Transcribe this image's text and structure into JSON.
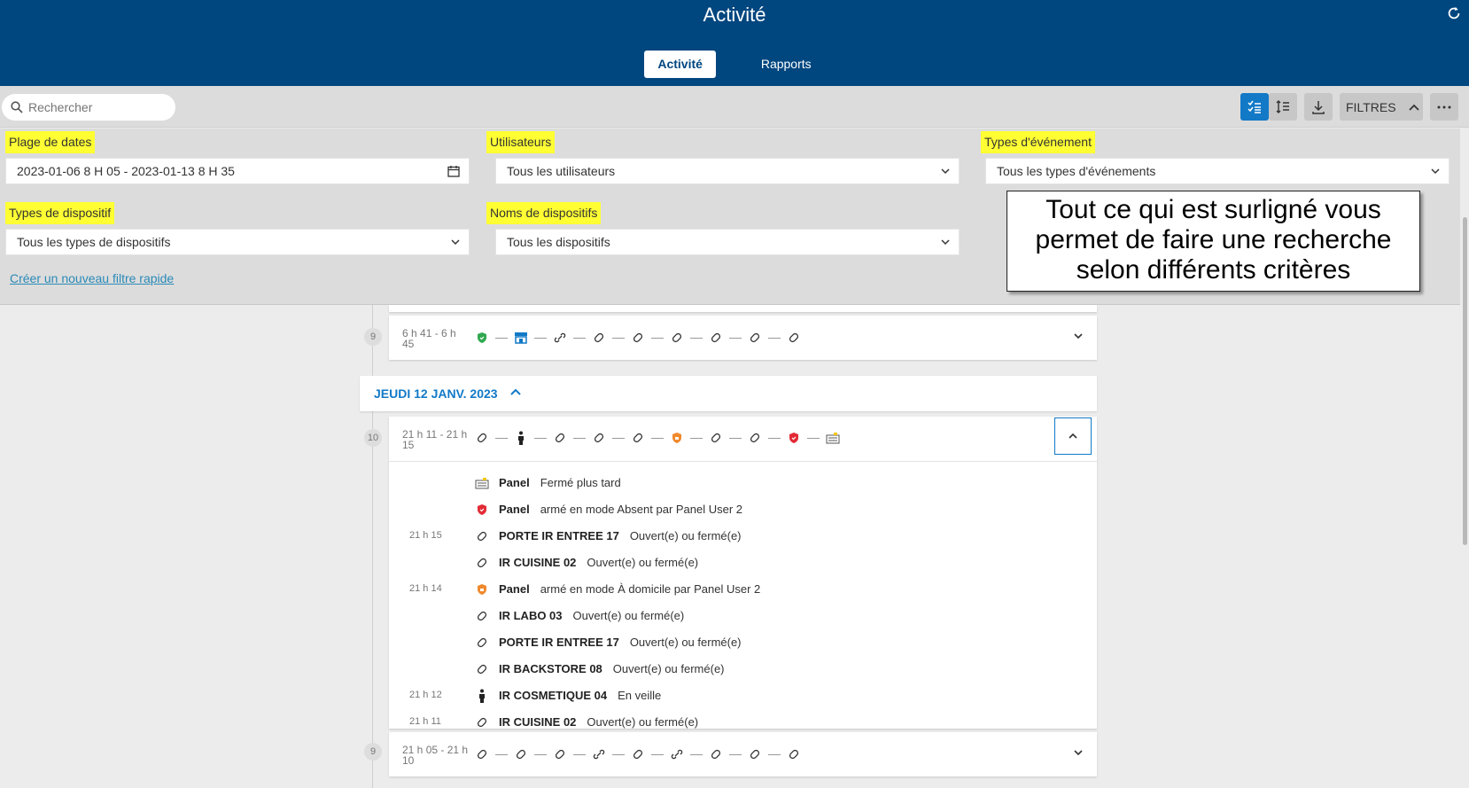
{
  "header": {
    "title": "Activité",
    "tabs": [
      {
        "label": "Activité",
        "active": true
      },
      {
        "label": "Rapports",
        "active": false
      }
    ]
  },
  "toolbar": {
    "search_placeholder": "Rechercher",
    "filters_label": "FILTRES"
  },
  "filters": {
    "date_range": {
      "label": "Plage de dates",
      "value": "2023-01-06 8 H 05 - 2023-01-13 8 H 35"
    },
    "users": {
      "label": "Utilisateurs",
      "value": "Tous les utilisateurs"
    },
    "event_types": {
      "label": "Types d'événement",
      "value": "Tous les types d'événements"
    },
    "device_types": {
      "label": "Types de dispositif",
      "value": "Tous les types de dispositifs"
    },
    "device_names": {
      "label": "Noms de dispositifs",
      "value": "Tous les dispositifs"
    },
    "quick_filter_link": "Créer un nouveau filtre rapide",
    "annotation": [
      "Tout ce qui est surligné vous",
      "permet de faire une recherche",
      "selon différents critères"
    ]
  },
  "timeline": {
    "group1": {
      "count": "9",
      "time_line1": "6 h 41 - 6 h",
      "time_line2": "45"
    },
    "date_header": "JEUDI 12 JANV. 2023",
    "group2": {
      "count": "10",
      "time_line1": "21 h 11 - 21 h",
      "time_line2": "15",
      "events": [
        {
          "time": "",
          "icon": "panel-icon",
          "name": "Panel",
          "desc": "Fermé plus tard"
        },
        {
          "time": "",
          "icon": "shield-red-icon",
          "name": "Panel",
          "desc": "armé en mode Absent par Panel User 2"
        },
        {
          "time": "21 h 15",
          "icon": "link-icon",
          "name": "PORTE IR ENTREE 17",
          "desc": "Ouvert(e) ou fermé(e)"
        },
        {
          "time": "",
          "icon": "link-icon",
          "name": "IR CUISINE 02",
          "desc": "Ouvert(e) ou fermé(e)"
        },
        {
          "time": "21 h 14",
          "icon": "shield-orange-icon",
          "name": "Panel",
          "desc": "armé en mode À domicile par Panel User 2"
        },
        {
          "time": "",
          "icon": "link-icon",
          "name": "IR LABO 03",
          "desc": "Ouvert(e) ou fermé(e)"
        },
        {
          "time": "",
          "icon": "link-icon",
          "name": "PORTE IR ENTREE 17",
          "desc": "Ouvert(e) ou fermé(e)"
        },
        {
          "time": "",
          "icon": "link-icon",
          "name": "IR BACKSTORE 08",
          "desc": "Ouvert(e) ou fermé(e)"
        },
        {
          "time": "21 h 12",
          "icon": "person-icon",
          "name": "IR COSMETIQUE 04",
          "desc": "En veille"
        },
        {
          "time": "21 h 11",
          "icon": "link-icon",
          "name": "IR CUISINE 02",
          "desc": "Ouvert(e) ou fermé(e)"
        }
      ]
    },
    "group3": {
      "count": "9",
      "time_line1": "21 h 05 - 21 h",
      "time_line2": "10"
    }
  },
  "colors": {
    "header_bg": "#00467f",
    "accent": "#1279c7",
    "highlight": "#ffff33"
  }
}
